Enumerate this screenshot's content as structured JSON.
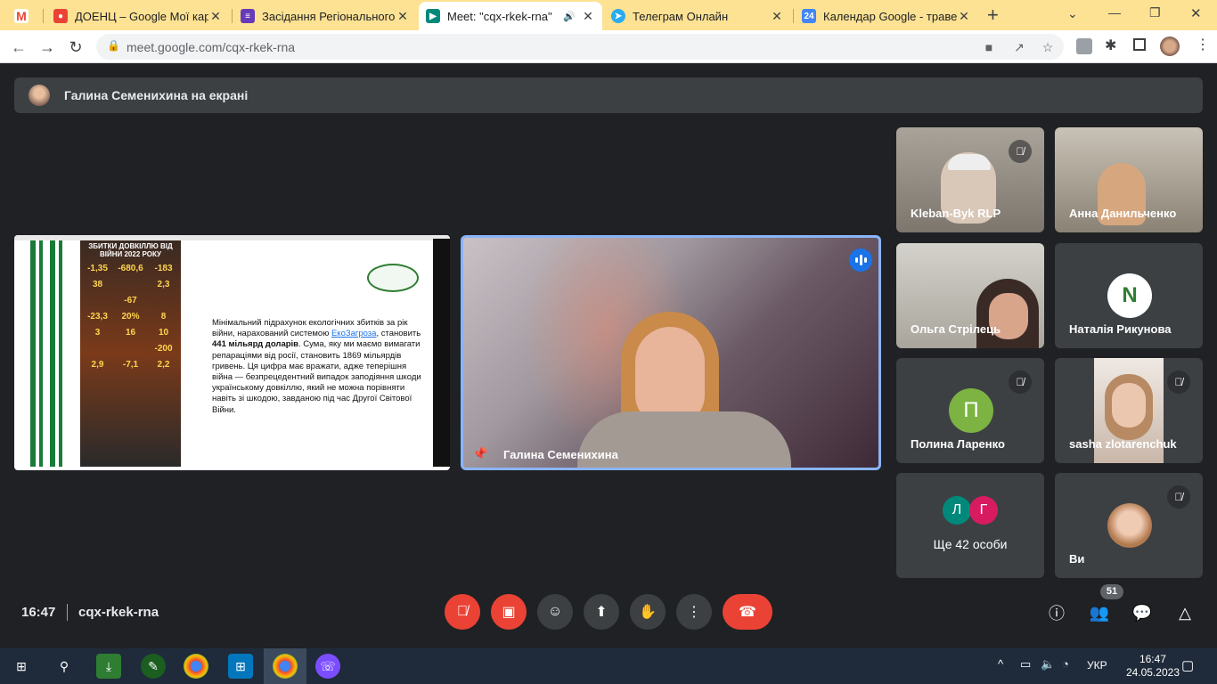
{
  "browser": {
    "tabs": [
      {
        "title": "",
        "icon": "gmail-icon",
        "color": "#ea4335"
      },
      {
        "title": "ДОЕНЦ – Google Мої карти",
        "icon": "maps-icon",
        "color": "#ea4335"
      },
      {
        "title": "Засідання Регіонального с",
        "icon": "forms-icon",
        "color": "#673ab7"
      },
      {
        "title": "Meet: \"cqx-rkek-rna\"",
        "icon": "meet-icon",
        "color": "#00897b"
      },
      {
        "title": "Телеграм Онлайн",
        "icon": "telegram-icon",
        "color": "#2aabee"
      },
      {
        "title": "Календар Google - травен",
        "icon": "calendar-icon",
        "color": "#4285f4",
        "icon_text": "24"
      }
    ],
    "new_tab": "+",
    "url": "meet.google.com/cqx-rkek-rna"
  },
  "meet": {
    "banner": "Галина Семенихина на екрані",
    "presentation": {
      "info_title": "ЗБИТКИ ДОВКІЛЛЮ ВІД ВІЙНИ 2022 РОКУ",
      "stats": [
        "-1,35",
        "-680,6",
        "-183",
        "38",
        "",
        "2,3",
        "",
        "-67",
        "",
        "-23,3",
        "20%",
        "8",
        "3",
        "16",
        "10",
        "",
        "",
        "-200",
        "2,9",
        "-7,1",
        "2,2"
      ],
      "text_before": "Мінімальний підрахунок екологічних збитків за рік війни, нарахований системою ",
      "link": "ЕкоЗагроза",
      "text_mid": ", становить ",
      "bold": "441 мільярд доларів",
      "text_after": ". Сума, яку ми маємо вимагати репараціями від росії, становить 1869 мільярдів гривень. Ця цифра має вражати, адже теперішня війна — безпрецедентний випадок заподіяння шкоди українському довкіллю, який не можна порівняти навіть зі шкодою, завданою під час Другої Світової Війни."
    },
    "speaker": {
      "name": "Галина Семенихина"
    },
    "participants": [
      {
        "name": "Kleban-Byk RLP",
        "muted": true
      },
      {
        "name": "Анна Данильченко",
        "muted": false
      },
      {
        "name": "Ольга Стрілець",
        "muted": false
      },
      {
        "name": "Наталія Рикунова",
        "muted": false,
        "initial": "N"
      },
      {
        "name": "Полина Ларенко",
        "muted": true,
        "initial": "П"
      },
      {
        "name": "sasha zlotarenchuk",
        "muted": true
      },
      {
        "name": "Ще 42 особи",
        "initials": [
          "Л",
          "Г"
        ]
      },
      {
        "name": "Ви",
        "muted": true
      }
    ],
    "time": "16:47",
    "code": "cqx-rkek-rna",
    "people_count": "51"
  },
  "taskbar": {
    "lang": "УКР",
    "time": "16:47",
    "date": "24.05.2023"
  }
}
